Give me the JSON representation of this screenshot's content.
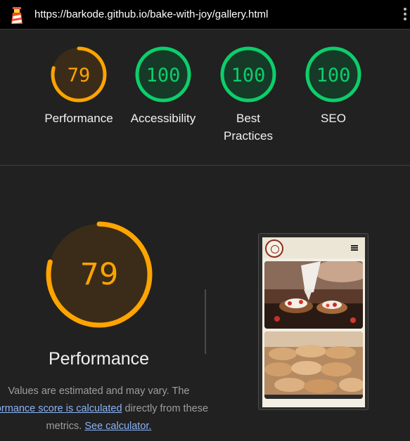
{
  "browser": {
    "url": "https://barkode.github.io/bake-with-joy/gallery.html"
  },
  "colors": {
    "average": "#ffa400",
    "pass": "#0cce6b"
  },
  "summary": [
    {
      "score": 79,
      "label": "Performance",
      "status": "average"
    },
    {
      "score": 100,
      "label": "Accessibility",
      "status": "pass"
    },
    {
      "score": 100,
      "label": "Best Practices",
      "status": "pass"
    },
    {
      "score": 100,
      "label": "SEO",
      "status": "pass"
    }
  ],
  "detail": {
    "score": 79,
    "title": "Performance",
    "desc_start": "Values are estimated and may vary. The",
    "link1": "rformance score is calculated",
    "desc_mid": " directly from these",
    "desc_end": "metrics.",
    "link2": "See calculator."
  },
  "icons": {
    "logo": "lighthouse-icon",
    "menu": "kebab-menu-icon",
    "phone_menu": "hamburger-icon"
  }
}
